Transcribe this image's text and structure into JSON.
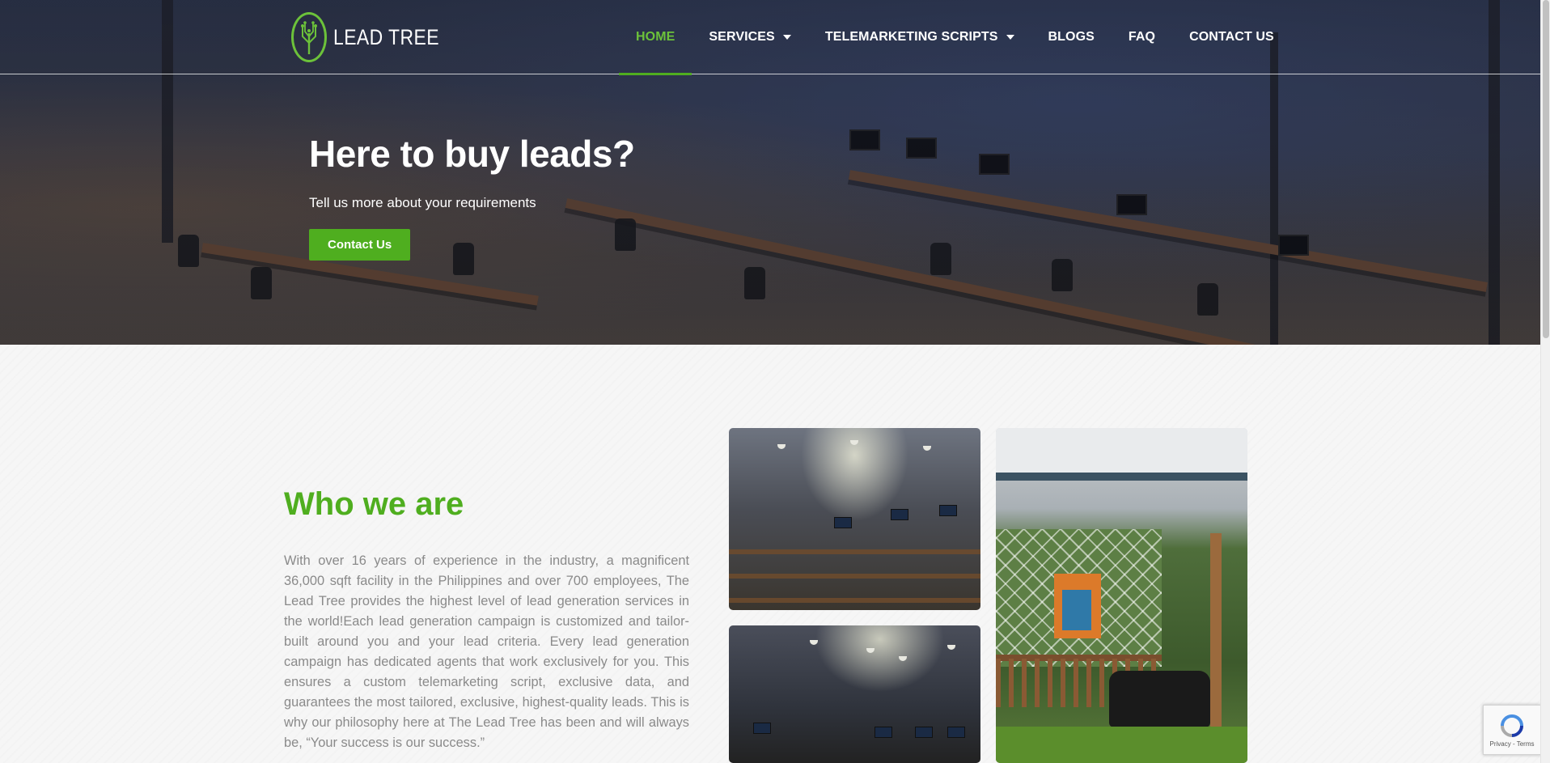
{
  "brand": {
    "logo_text": "LEAD TREE",
    "accent_color": "#4fae1f"
  },
  "nav": {
    "items": [
      {
        "label": "HOME",
        "active": true,
        "dropdown": false
      },
      {
        "label": "SERVICES",
        "active": false,
        "dropdown": true
      },
      {
        "label": "TELEMARKETING SCRIPTS",
        "active": false,
        "dropdown": true
      },
      {
        "label": "BLOGS",
        "active": false,
        "dropdown": false
      },
      {
        "label": "FAQ",
        "active": false,
        "dropdown": false
      },
      {
        "label": "CONTACT US",
        "active": false,
        "dropdown": false
      }
    ]
  },
  "hero": {
    "title": "Here to buy leads?",
    "subtitle": "Tell us more about your requirements",
    "cta_label": "Contact Us"
  },
  "about": {
    "title": "Who we are",
    "body": "With over 16 years of experience in the industry, a magnificent 36,000 sqft facility in the Philippines and over 700 employees, The Lead Tree provides the highest level of lead generation services in the world!Each lead generation campaign is customized and tailor-built around you and your lead criteria. Every lead generation campaign has dedicated agents that work exclusively for you. This ensures a custom telemarketing script, exclusive data, and guarantees the most tailored, exclusive, highest-quality leads. This is why our philosophy here at The Lead Tree has been and will always be, “Your success is our success.”"
  },
  "recaptcha": {
    "text": "Privacy - Terms"
  }
}
